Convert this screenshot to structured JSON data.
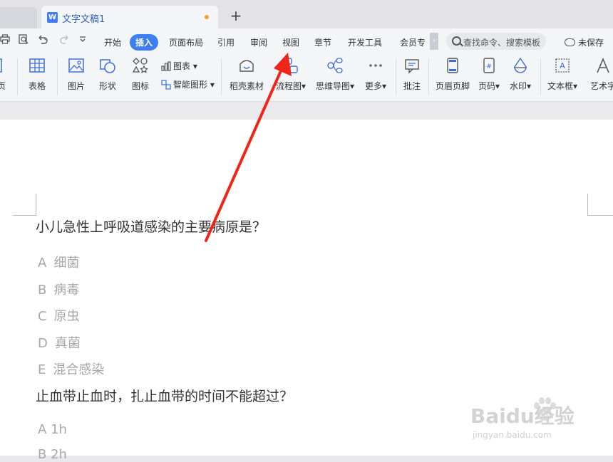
{
  "tabs": {
    "doc_title": "文字文稿1",
    "doc_icon_letter": "W",
    "add_label": "+"
  },
  "menu": {
    "items": [
      "开始",
      "插入",
      "页面布局",
      "引用",
      "审阅",
      "视图",
      "章节",
      "开发工具",
      "会员专"
    ],
    "active": "插入",
    "more_label": "›",
    "search_placeholder": "查找命令、搜索模板",
    "unsaved_label": "未保存"
  },
  "ribbon": {
    "edge_label": "页",
    "table": "表格",
    "picture": "图片",
    "shape": "形状",
    "icon": "图标",
    "chart": "图表",
    "smart_shape": "智能图形",
    "material": "稻壳素材",
    "flowchart": "流程图",
    "mindmap": "思维导图",
    "more": "更多",
    "comment": "批注",
    "header_footer": "页眉页脚",
    "page_number": "页码",
    "watermark": "水印",
    "textbox": "文本框",
    "wordart": "艺术字"
  },
  "document": {
    "q1": "小儿急性上呼吸道感染的主要病原是？",
    "q1_options": [
      {
        "letter": "A",
        "text": "细菌"
      },
      {
        "letter": "B",
        "text": "病毒"
      },
      {
        "letter": "C",
        "text": "原虫"
      },
      {
        "letter": "D",
        "text": "真菌"
      },
      {
        "letter": "E",
        "text": "混合感染"
      }
    ],
    "q2": "止血带止血时，扎止血带的时间不能超过？",
    "q2_options": [
      {
        "letter": "A",
        "text": "1h"
      },
      {
        "letter": "B",
        "text": "2h"
      }
    ]
  },
  "watermark": {
    "brand": "Baidu经验",
    "url": "jingyan.baidu.com"
  },
  "colors": {
    "accent": "#3b7ff2",
    "arrow": "#f02418"
  }
}
